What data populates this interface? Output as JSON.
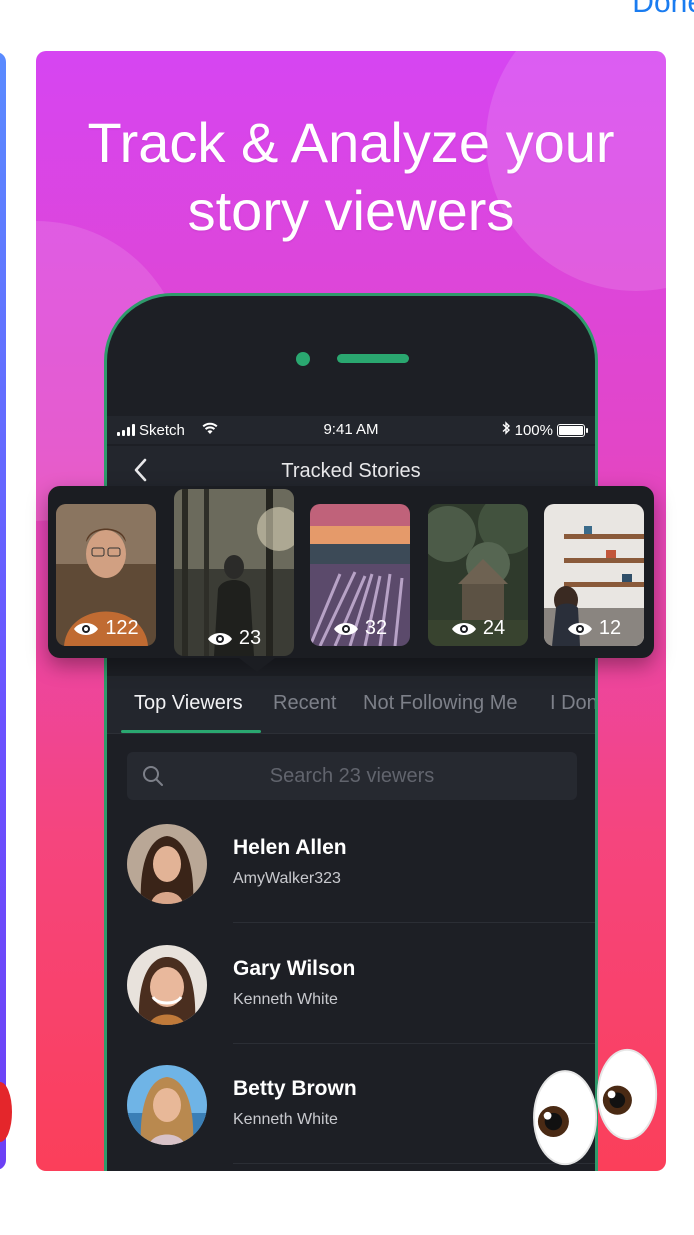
{
  "top_link": {
    "label": "Done"
  },
  "card": {
    "headline_line1": "Track & Analyze your",
    "headline_line2": "story viewers",
    "colors": {
      "gradient_top": "#d645f2",
      "gradient_bottom": "#fb3f5a",
      "accent_green": "#2aa770"
    }
  },
  "status_bar": {
    "carrier": "Sketch",
    "time": "9:41 AM",
    "battery": "100%"
  },
  "nav": {
    "title": "Tracked Stories"
  },
  "stories": [
    {
      "views": "122",
      "scene": "portrait-man-glasses"
    },
    {
      "views": "23",
      "scene": "person-in-forest"
    },
    {
      "views": "32",
      "scene": "sunset-field"
    },
    {
      "views": "24",
      "scene": "forest-cabin"
    },
    {
      "views": "12",
      "scene": "kitchen-shelves"
    }
  ],
  "tabs": [
    {
      "label": "Top Viewers",
      "active": true
    },
    {
      "label": "Recent",
      "active": false
    },
    {
      "label": "Not Following Me",
      "active": false
    },
    {
      "label": "I Don",
      "active": false
    }
  ],
  "search": {
    "placeholder": "Search 23 viewers"
  },
  "viewers": [
    {
      "name": "Helen Allen",
      "username": "AmyWalker323"
    },
    {
      "name": "Gary Wilson",
      "username": "Kenneth White"
    },
    {
      "name": "Betty Brown",
      "username": "Kenneth White"
    }
  ],
  "decoration": {
    "emoji": "eyes-icon"
  }
}
